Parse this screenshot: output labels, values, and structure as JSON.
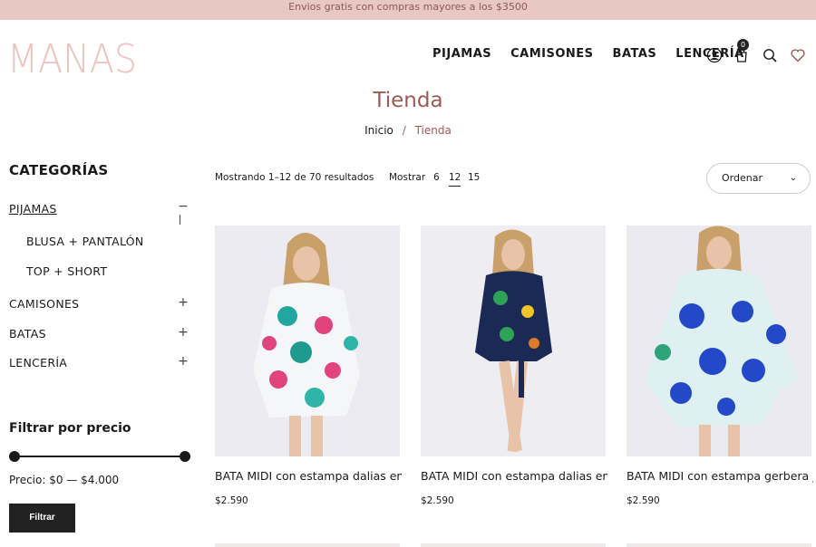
{
  "topbar": {
    "text": "Envios gratis con compras mayores a los $3500"
  },
  "logo": {
    "text": "MANAS"
  },
  "nav": {
    "items": [
      "PIJAMAS",
      "CAMISONES",
      "BATAS",
      "LENCERÍA"
    ]
  },
  "header_icons": [
    "user-icon",
    "cart-icon",
    "search-icon",
    "heart-icon"
  ],
  "cart": {
    "count": "0"
  },
  "page": {
    "title": "Tienda"
  },
  "breadcrumb": {
    "home": "Inicio",
    "separator": "/",
    "current": "Tienda"
  },
  "sidebar": {
    "title": "CATEGORÍAS",
    "categories": [
      {
        "label": "PIJAMAS",
        "toggle": "−"
      },
      {
        "label": "BLUSA + PANTALÓN"
      },
      {
        "label": "TOP + SHORT"
      },
      {
        "label": "CAMISONES",
        "toggle": "+"
      },
      {
        "label": "BATAS",
        "toggle": "+"
      },
      {
        "label": "LENCERÍA",
        "toggle": "+"
      }
    ],
    "filter": {
      "title": "Filtrar por precio",
      "price_label": "Precio: $0 — $4.000",
      "button": "Filtrar",
      "range_fraction": [
        0,
        1
      ]
    }
  },
  "toolbar": {
    "results": "Mostrando 1–12 de 70 resultados",
    "show_label": "Mostrar",
    "show_options": [
      "6",
      "12",
      "15"
    ],
    "show_selected": "12",
    "sort": "Ordenar"
  },
  "products": [
    {
      "name": "BATA MIDI con estampa dalias en...",
      "price": "$2.590"
    },
    {
      "name": "BATA MIDI con estampa dalias en...",
      "price": "$2.590"
    },
    {
      "name": "BATA MIDI con estampa gerbera j...",
      "price": "$2.590"
    }
  ],
  "colors": {
    "accent": "#9c5a54",
    "topbar_bg": "#e9c7c3",
    "logo": "#ecc3bd",
    "button_bg": "#222222"
  }
}
